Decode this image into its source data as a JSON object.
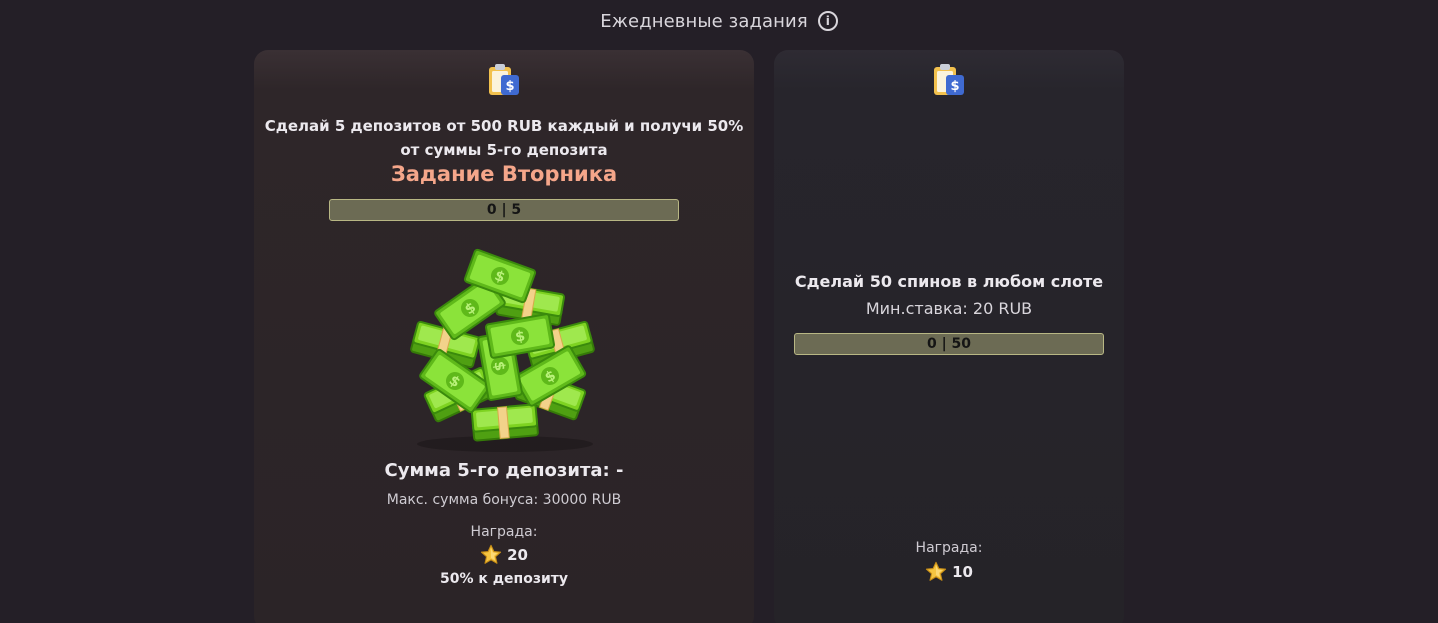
{
  "header": {
    "title": "Ежедневные задания",
    "info_icon": "info-icon"
  },
  "tasks": [
    {
      "icon": "clipboard-dollar-icon",
      "description": "Сделай 5 депозитов от 500 RUB каждый и получи 50% от суммы 5-го депозита",
      "title": "Задание Вторника",
      "progress_text": "0 | 5",
      "progress": {
        "current": 0,
        "total": 5
      },
      "image": "money-stack-illustration",
      "deposit_sum": "Сумма 5-го депозита: -",
      "max_bonus": "Макс. сумма бонуса: 30000 RUB",
      "reward_label": "Награда:",
      "reward_icon": "star-icon",
      "reward_value": "20",
      "reward_extra": "50% к депозиту"
    },
    {
      "icon": "clipboard-dollar-icon",
      "description": "Сделай 50 спинов в любом слоте",
      "min_bet": "Мин.ставка: 20 RUB",
      "progress_text": "0 | 50",
      "progress": {
        "current": 0,
        "total": 50
      },
      "reward_label": "Награда:",
      "reward_icon": "star-icon",
      "reward_value": "10"
    }
  ],
  "colors": {
    "background": "#241f27",
    "accent_title": "#f5a68a",
    "progress_fill": "#6c6b54",
    "progress_border": "#b8b784",
    "money_green": "#7ed321",
    "star_gold": "#f5c542"
  }
}
